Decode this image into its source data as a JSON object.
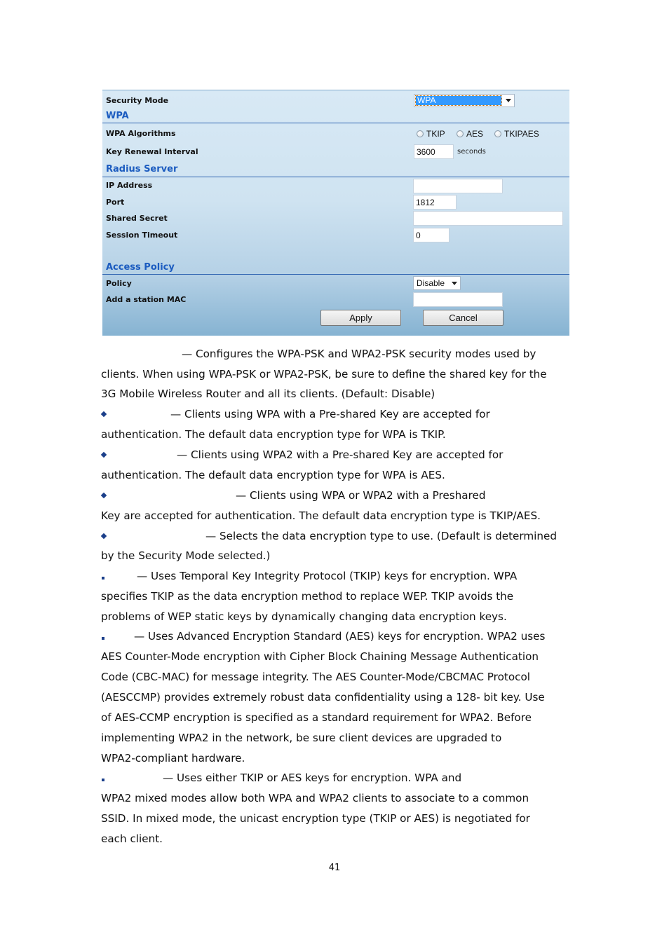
{
  "form": {
    "security_mode": {
      "label": "Security Mode",
      "value": "WPA"
    },
    "sections": {
      "wpa": "WPA",
      "radius": "Radius Server",
      "access_policy": "Access Policy"
    },
    "wpa_algorithms": {
      "label": "WPA Algorithms",
      "options": [
        "TKIP",
        "AES",
        "TKIPAES"
      ],
      "selected": null
    },
    "key_renewal": {
      "label": "Key Renewal Interval",
      "value": "3600",
      "unit": "seconds"
    },
    "ip_address": {
      "label": "IP Address",
      "value": ""
    },
    "port": {
      "label": "Port",
      "value": "1812"
    },
    "shared_secret": {
      "label": "Shared Secret",
      "value": ""
    },
    "session_timeout": {
      "label": "Session Timeout",
      "value": "0"
    },
    "policy": {
      "label": "Policy",
      "value": "Disable"
    },
    "station_mac": {
      "label": "Add a station MAC",
      "value": ""
    },
    "apply_label": "Apply",
    "cancel_label": "Cancel"
  },
  "text": {
    "intro_1": "— Configures the WPA-PSK and WPA2-PSK security modes used by",
    "intro_2": "clients. When using WPA-PSK or WPA2-PSK, be sure to define the shared key for the",
    "intro_3": "3G Mobile Wireless Router and all its clients. (Default: Disable)",
    "b1_1": "— Clients using WPA with a Pre-shared Key are accepted for",
    "b1_2": "authentication. The default data encryption type for WPA is TKIP.",
    "b2_1": "— Clients using WPA2 with a Pre-shared Key are accepted for",
    "b2_2": "authentication. The default data encryption type for WPA is AES.",
    "b3_1": "— Clients using WPA or WPA2 with a Preshared",
    "b3_2": "Key are accepted for authentication. The default data encryption type is TKIP/AES.",
    "b4_1": "— Selects the data encryption type to use. (Default is determined",
    "b4_2": "by the Security Mode selected.)",
    "s1_1": "— Uses Temporal Key Integrity Protocol (TKIP) keys for encryption. WPA",
    "s1_2": "specifies TKIP as the data encryption method to replace WEP. TKIP avoids the",
    "s1_3": "problems of WEP static keys by dynamically changing data encryption keys.",
    "s2_1": "— Uses Advanced Encryption Standard (AES) keys for encryption. WPA2 uses",
    "s2_2": "AES Counter-Mode encryption with Cipher Block Chaining Message Authentication",
    "s2_3": "Code (CBC-MAC) for message integrity. The AES Counter-Mode/CBCMAC Protocol",
    "s2_4": "(AESCCMP) provides extremely robust data confidentiality using a 128- bit key. Use",
    "s2_5": "of AES-CCMP encryption is specified as a standard requirement for WPA2. Before",
    "s2_6": "implementing WPA2 in the network, be sure client devices are upgraded to",
    "s2_7": "WPA2-compliant hardware.",
    "s3_1": "— Uses either TKIP or AES keys for encryption. WPA and",
    "s3_2": "WPA2 mixed modes allow both WPA and WPA2 clients to associate to a common",
    "s3_3": "SSID. In mixed mode, the unicast encryption type (TKIP or AES) is negotiated for",
    "s3_4": "each client."
  },
  "page_number": "41"
}
